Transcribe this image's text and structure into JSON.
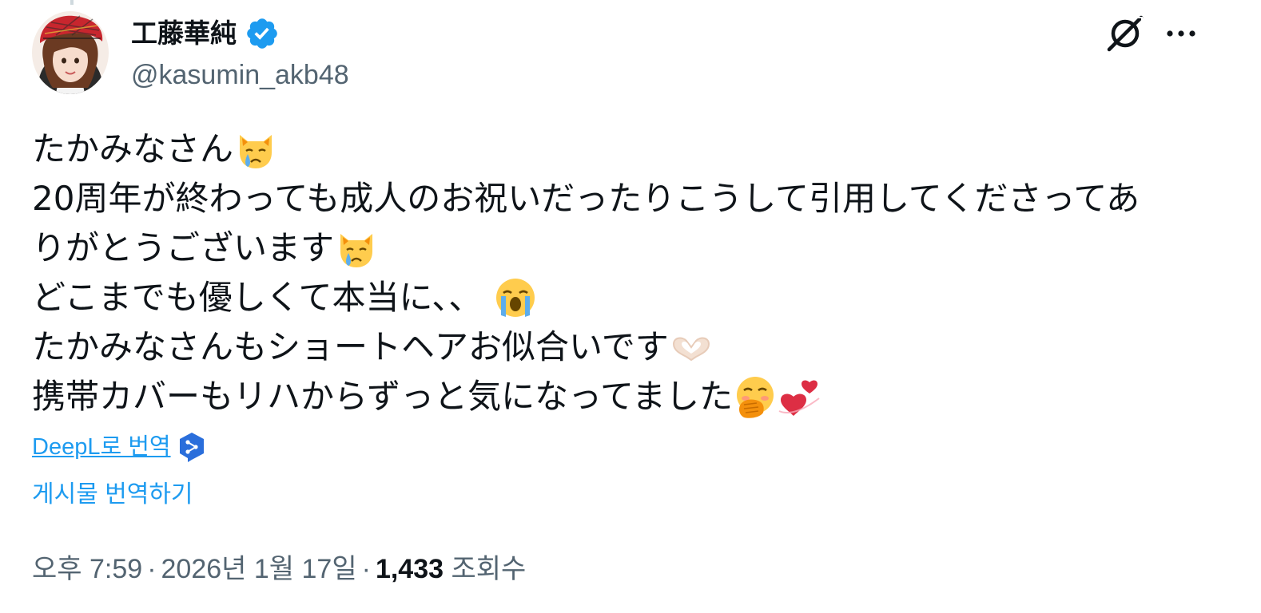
{
  "author": {
    "display_name": "工藤華純",
    "handle": "@kasumin_akb48",
    "verified": true,
    "avatar_icon": "profile-photo"
  },
  "actions": {
    "grok_icon": "grok-icon",
    "more_icon": "more-horizontal-icon"
  },
  "tweet": {
    "lines": [
      {
        "text": "たかみなさん",
        "emoji": [
          "crying-cat-emoji"
        ]
      },
      {
        "text": "20周年が終わっても成人のお祝いだったりこうして引用してくださってあ",
        "emoji": []
      },
      {
        "text": "りがとうございます",
        "emoji": [
          "crying-cat-emoji"
        ]
      },
      {
        "text": "どこまでも優しくて本当に、、",
        "emoji": [
          "loudly-crying-emoji"
        ]
      },
      {
        "text": "たかみなさんもショートヘアお似合いです",
        "emoji": [
          "heart-hands-emoji"
        ]
      },
      {
        "text": "携帯カバーもリハからずっと気になってました",
        "emoji": [
          "hand-over-mouth-emoji",
          "two-hearts-emoji"
        ]
      }
    ]
  },
  "translation": {
    "deepl_label": "DeepL로 번역",
    "translate_post_label": "게시물 번역하기"
  },
  "meta": {
    "time": "오후 7:59",
    "date": "2026년 1월 17일",
    "separator": "·",
    "views_count": "1,433",
    "views_label": "조회수"
  },
  "colors": {
    "link": "#1d9bf0",
    "secondary_text": "#536471",
    "primary_text": "#0f1419",
    "verified_badge": "#1d9bf0"
  }
}
